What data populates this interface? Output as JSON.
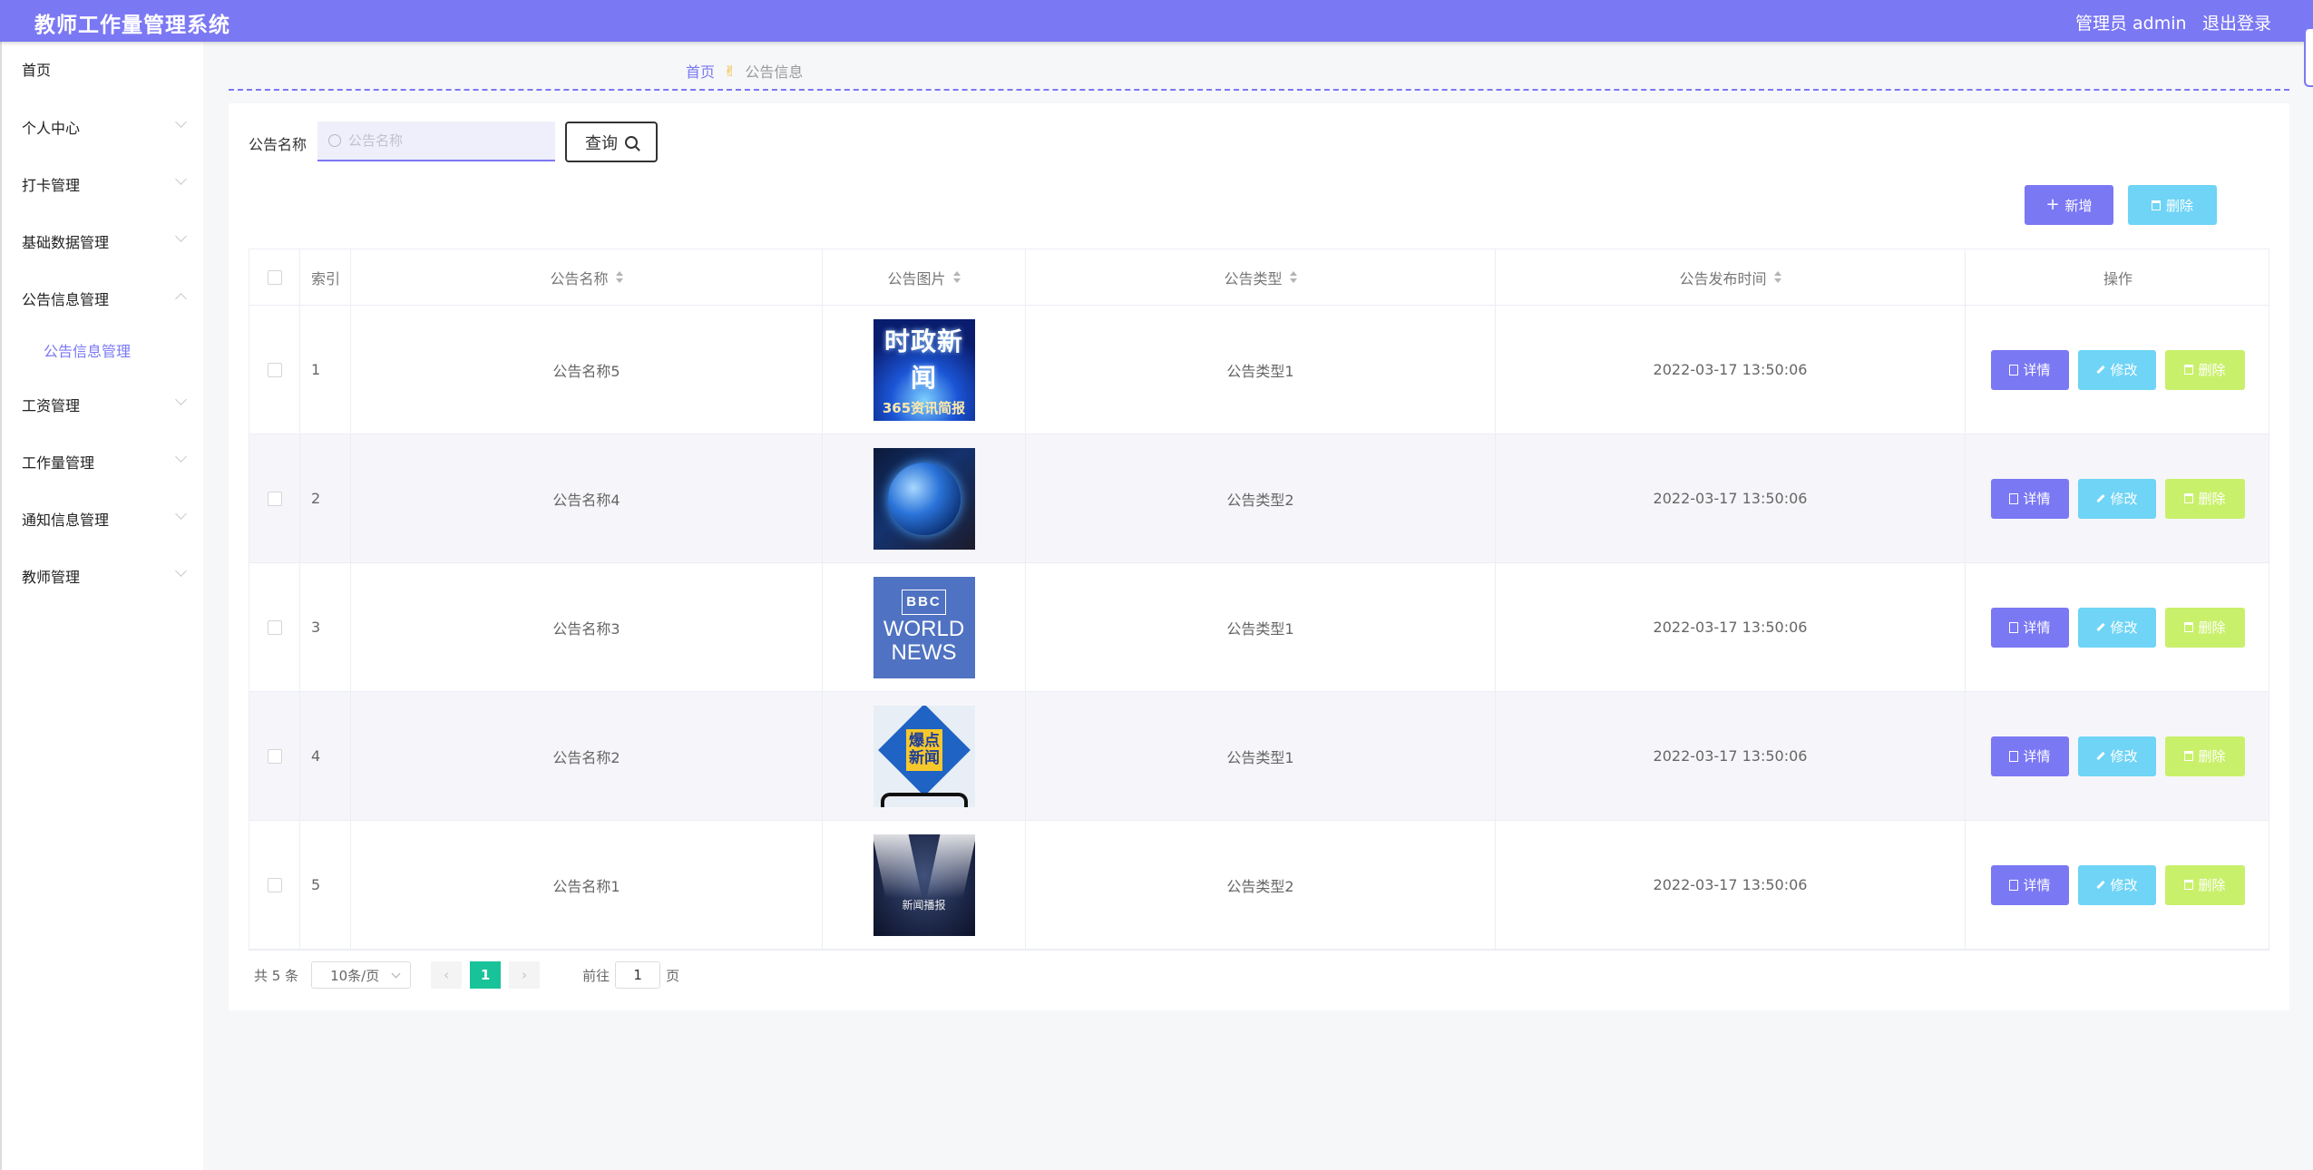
{
  "header": {
    "title": "教师工作量管理系统",
    "admin": "管理员 admin",
    "logout": "退出登录"
  },
  "sidebar": {
    "items": [
      {
        "label": "首页"
      },
      {
        "label": "个人中心"
      },
      {
        "label": "打卡管理"
      },
      {
        "label": "基础数据管理"
      },
      {
        "label": "公告信息管理"
      },
      {
        "label": "工资管理"
      },
      {
        "label": "工作量管理"
      },
      {
        "label": "通知信息管理"
      },
      {
        "label": "教师管理"
      }
    ],
    "active_sub": "公告信息管理"
  },
  "breadcrumb": {
    "home": "首页",
    "separator": "✌",
    "current": "公告信息"
  },
  "search": {
    "label": "公告名称",
    "placeholder": "公告名称",
    "value": "",
    "button": "查询"
  },
  "actions": {
    "add": "新增",
    "delete": "删除"
  },
  "table": {
    "headers": {
      "index": "索引",
      "name": "公告名称",
      "image": "公告图片",
      "type": "公告类型",
      "time": "公告发布时间",
      "ops": "操作"
    },
    "rows": [
      {
        "index": "1",
        "name": "公告名称5",
        "image": "时政新闻 365资讯简报",
        "type": "公告类型1",
        "time": "2022-03-17 13:50:06"
      },
      {
        "index": "2",
        "name": "公告名称4",
        "image": "globe",
        "type": "公告类型2",
        "time": "2022-03-17 13:50:06"
      },
      {
        "index": "3",
        "name": "公告名称3",
        "image": "BBC WORLD NEWS",
        "type": "公告类型1",
        "time": "2022-03-17 13:50:06"
      },
      {
        "index": "4",
        "name": "公告名称2",
        "image": "爆点新闻",
        "type": "公告类型1",
        "time": "2022-03-17 13:50:06"
      },
      {
        "index": "5",
        "name": "公告名称1",
        "image": "新闻播报",
        "type": "公告类型2",
        "time": "2022-03-17 13:50:06"
      }
    ],
    "row_actions": {
      "detail": "详情",
      "edit": "修改",
      "delete": "删除"
    }
  },
  "thumb_text": {
    "t1_main": "时政新闻",
    "t1_sub": "365资讯简报",
    "t3_logo": "BBC",
    "t3_l1": "WORLD",
    "t3_l2": "NEWS",
    "t4_l1": "爆点",
    "t4_l2": "新闻",
    "t5": "新闻播报"
  },
  "pagination": {
    "total": "共 5 条",
    "page_size": "10条/页",
    "prev": "‹",
    "next": "›",
    "current": "1",
    "goto_label": "前往",
    "goto_value": "1",
    "page_unit": "页"
  },
  "colors": {
    "primary": "#7b78f4",
    "info": "#6fd4f6",
    "lime": "#c9f06b",
    "pager_active": "#19c39a"
  }
}
